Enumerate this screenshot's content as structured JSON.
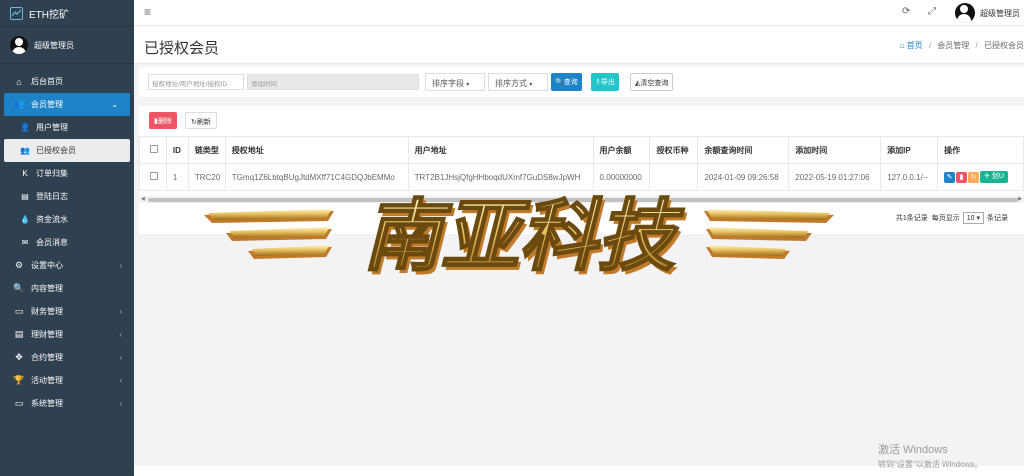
{
  "sidebar": {
    "logo": "ETH挖矿",
    "user": "超级管理员",
    "items": [
      {
        "label": "后台首页",
        "icon": "home-icon",
        "glyph": "⌂"
      },
      {
        "label": "会员管理",
        "icon": "users-icon",
        "glyph": "👥",
        "active": true,
        "expanded": true
      },
      {
        "label": "用户管理",
        "icon": "user-icon",
        "glyph": "👤",
        "sub": true
      },
      {
        "label": "已授权会员",
        "icon": "users-icon",
        "glyph": "👥",
        "sub": true,
        "current": true
      },
      {
        "label": "订单归集",
        "icon": "k-icon",
        "glyph": "K",
        "sub": true
      },
      {
        "label": "登陆日志",
        "icon": "list-icon",
        "glyph": "▤",
        "sub": true
      },
      {
        "label": "资金流水",
        "icon": "drop-icon",
        "glyph": "💧",
        "sub": true
      },
      {
        "label": "会员消息",
        "icon": "envelope-icon",
        "glyph": "✉",
        "sub": true
      },
      {
        "label": "设置中心",
        "icon": "gears-icon",
        "glyph": "⚙",
        "chev": true
      },
      {
        "label": "内容管理",
        "icon": "search-icon",
        "glyph": "🔍"
      },
      {
        "label": "财务管理",
        "icon": "card-icon",
        "glyph": "▭",
        "chev": true
      },
      {
        "label": "理财管理",
        "icon": "doc-icon",
        "glyph": "▤",
        "chev": true
      },
      {
        "label": "合约管理",
        "icon": "arrows-icon",
        "glyph": "✥",
        "chev": true
      },
      {
        "label": "活动管理",
        "icon": "trophy-icon",
        "glyph": "🏆",
        "chev": true
      },
      {
        "label": "系统管理",
        "icon": "monitor-icon",
        "glyph": "▭",
        "chev": true
      }
    ]
  },
  "topbar": {
    "user": "超级管理员"
  },
  "page": {
    "title": "已授权会员",
    "breadcrumb": [
      "首页",
      "会员管理",
      "已授权会员"
    ]
  },
  "filters": {
    "search_placeholder": "授权地址/用户地址/授权ID",
    "time_placeholder": "添加时间",
    "sort_field": "排序字段",
    "sort_order": "排序方式",
    "query": "查询",
    "export": "导出",
    "clear": "清空查询"
  },
  "toolbar": {
    "delete": "删除",
    "refresh": "刷新"
  },
  "table": {
    "headers": [
      "ID",
      "链类型",
      "授权地址",
      "用户地址",
      "用户余额",
      "授权币种",
      "余额查询时间",
      "添加时间",
      "添加IP",
      "操作"
    ],
    "rows": [
      {
        "id": "1",
        "chain": "TRC20",
        "auth_address": "TGmq1Z6LbtqBUgJtdMXff71C4GDQJbEMMo",
        "user_address": "TRT2B1JHsjQfgHHboqdUXmf7GuDS8wJpWH",
        "balance": "0.00000000",
        "coin": "",
        "query_time": "2024-01-09 09:26:58",
        "add_time": "2022-05-19 01:27:06",
        "ip": "127.0.0.1/--",
        "auth_btn": "划U"
      }
    ]
  },
  "pagination": {
    "total": "共1条记录",
    "per_page_label": "每页显示",
    "per_page": "10",
    "unit": "条记录"
  },
  "watermark": {
    "text": "南亚科技"
  },
  "windows": {
    "line1": "激活 Windows",
    "line2": "转到\"设置\"以激活 Windows。"
  }
}
